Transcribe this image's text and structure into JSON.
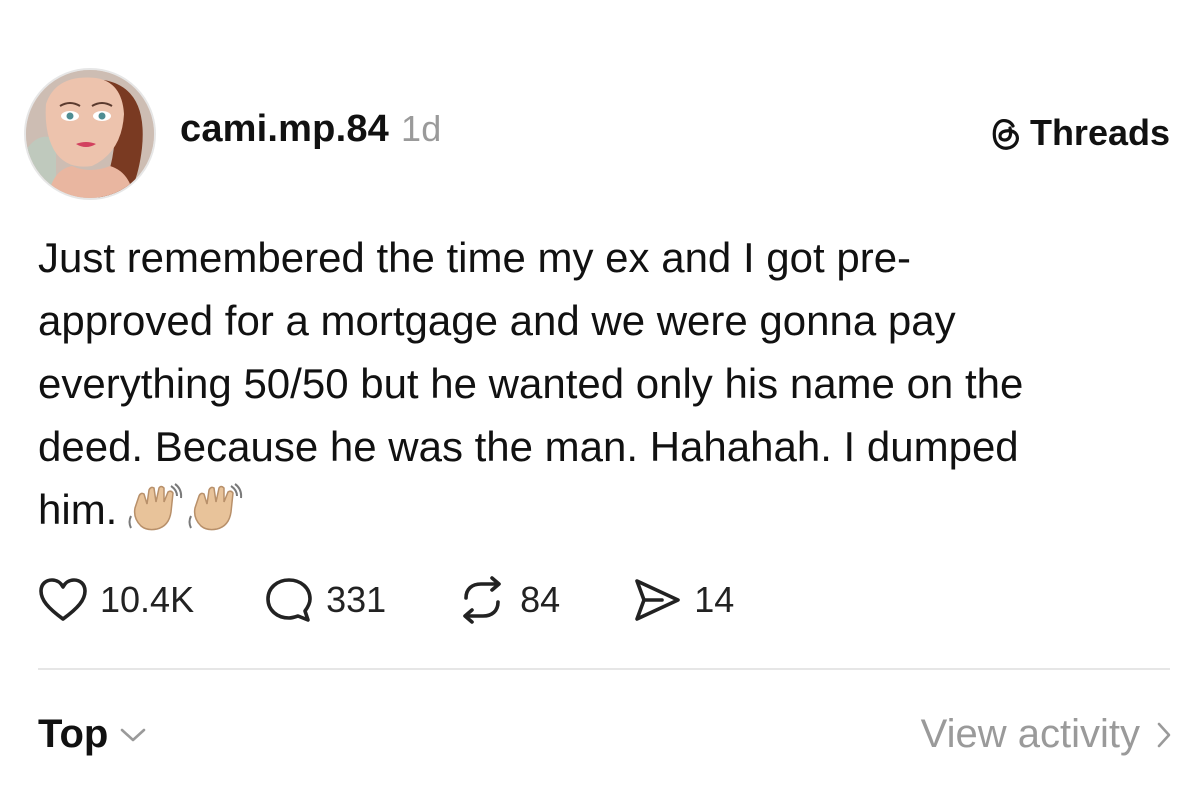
{
  "post": {
    "username": "cami.mp.84",
    "time_ago": "1d",
    "brand_label": "Threads",
    "text_lines": [
      "Just remembered the time my ex and I got pre-",
      "approved for a mortgage and we were gonna pay",
      "everything 50/50 but he wanted only his name on the",
      "deed. Because he was the man. Hahahah. I dumped",
      "him."
    ],
    "emoji": [
      "waving-hand-emoji",
      "waving-hand-emoji"
    ],
    "stats": {
      "likes": "10.4K",
      "replies": "331",
      "reposts": "84",
      "shares": "14"
    }
  },
  "footer": {
    "sort_label": "Top",
    "view_activity_label": "View activity"
  },
  "icons": {
    "like": "heart-icon",
    "reply": "comment-bubble-icon",
    "repost": "repost-arrows-icon",
    "share": "send-icon",
    "brand": "threads-logo-icon"
  },
  "colors": {
    "text": "#111111",
    "muted": "#9a9a9a",
    "divider": "#e6e6e6"
  }
}
